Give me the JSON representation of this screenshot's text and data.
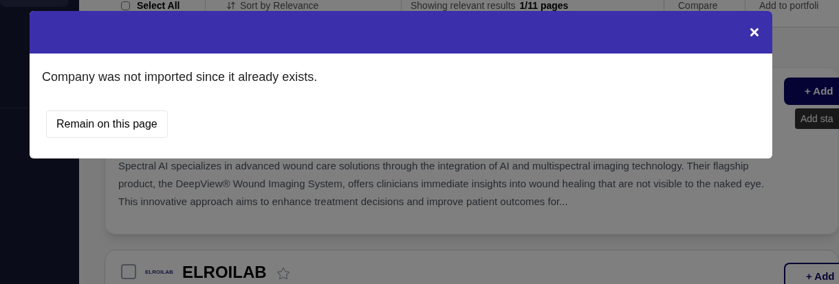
{
  "toolbar": {
    "select_all": {
      "label": "Select All",
      "checked": false
    },
    "sort": "Sort by Relevance",
    "results": {
      "label": "Showing relevant results",
      "pages": "1/11 pages"
    },
    "compare": "Compare",
    "add_to_portfolio": "Add to portfoli"
  },
  "cards": [
    {
      "kind": "expanded",
      "add_button": "+ Add",
      "tooltip": "Add sta",
      "description": "Spectral AI specializes in advanced wound care solutions through the integration of AI and multispectral imaging technology. Their flagship product, the DeepView® Wound Imaging System, offers clinicians immediate insights into wound healing that are not visible to the naked eye. This innovative approach aims to enhance treatment decisions and improve patient outcomes for..."
    },
    {
      "kind": "header",
      "checked": false,
      "logo": "ELROILAB",
      "name": "ELROILAB",
      "starred": false,
      "add_button": "+ Add"
    }
  ],
  "dialog": {
    "message": "Company was not imported since it already exists.",
    "button": "Remain on this page"
  }
}
